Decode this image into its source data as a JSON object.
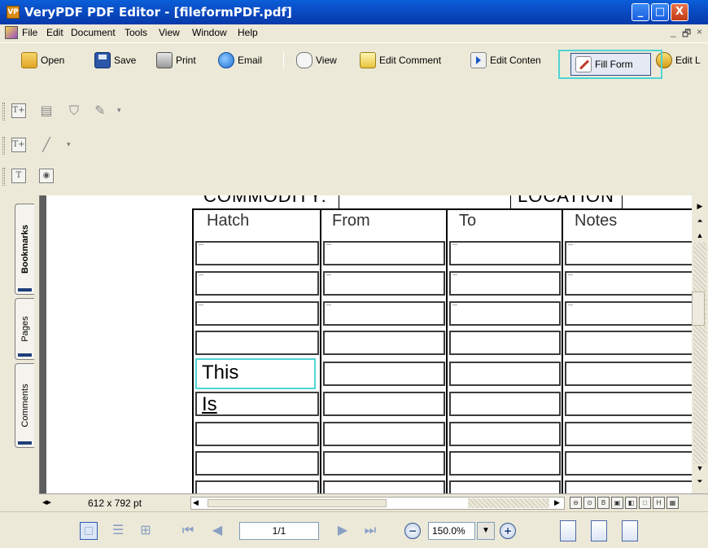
{
  "window": {
    "title": "VeryPDF PDF Editor - [fileformPDF.pdf]",
    "icon_text": "VP",
    "controls": {
      "minimize": "_",
      "maximize": "□",
      "close": "X"
    }
  },
  "menubar": {
    "items": [
      "File",
      "Edit",
      "Document",
      "Tools",
      "View",
      "Window",
      "Help"
    ],
    "mdi": {
      "minimize": "_",
      "restore": "🗗",
      "close": "×"
    }
  },
  "toolbar": {
    "open": "Open",
    "save": "Save",
    "print": "Print",
    "email": "Email",
    "view": "View",
    "edit_comment": "Edit Comment",
    "edit_content": "Edit Conten",
    "fill_form": "Fill Form",
    "edit_link": "Edit L"
  },
  "tools": {
    "row1": [
      "T+",
      "comment",
      "stamp",
      "pencil"
    ],
    "row2": [
      "T+",
      "line"
    ],
    "row3": [
      "T",
      "image"
    ]
  },
  "sidebar": {
    "tabs": [
      {
        "label": "Bookmarks",
        "active": true
      },
      {
        "label": "Pages",
        "active": false
      },
      {
        "label": "Comments",
        "active": false
      }
    ]
  },
  "document": {
    "header_labels": [
      "COMMODITY:",
      "LOCATION"
    ],
    "columns": [
      "Hatch",
      "From",
      "To",
      "Notes"
    ],
    "filled_cells": {
      "row5_hatch": "This",
      "row6_hatch": "Is"
    }
  },
  "statusbar": {
    "page_size": "612 x 792 pt"
  },
  "navigation": {
    "page_display": "1/1",
    "zoom": "150.0%"
  },
  "colors": {
    "titlebar": "#0a4bc4",
    "highlight": "#4fd4d4",
    "toolbar_bg": "#ece9d8"
  }
}
